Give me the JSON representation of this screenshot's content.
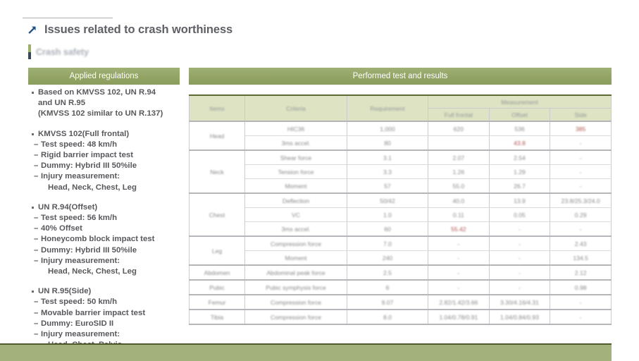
{
  "slide": {
    "title": "Issues related to crash worthiness",
    "title_icon": "arrow-up-right-icon",
    "subtitle": "Crash safety",
    "accent_green": "#9cb06b",
    "accent_dark": "#37495a",
    "header_green": "#93a566",
    "title_color": "#5e6066"
  },
  "columns": {
    "left_header": "Applied regulations",
    "right_header": "Performed test and results"
  },
  "left_column": {
    "blocks": [
      {
        "bullet": "Based on KMVSS 102, UN R.94",
        "continuations": [
          "and UN R.95",
          "(KMVSS 102 similar to UN R.137)"
        ],
        "sub_items": []
      },
      {
        "bullet": "KMVSS 102(Full frontal)",
        "continuations": [],
        "sub_items": [
          {
            "text": "Test speed: 48 km/h",
            "detail": ""
          },
          {
            "text": "Rigid barrier impact test",
            "detail": ""
          },
          {
            "text": "Dummy: Hybrid III 50%ile",
            "detail": ""
          },
          {
            "text": "Injury measurement:",
            "detail": "Head, Neck, Chest, Leg"
          }
        ]
      },
      {
        "bullet": "UN R.94(Offset)",
        "continuations": [],
        "sub_items": [
          {
            "text": "Test speed: 56 km/h",
            "detail": ""
          },
          {
            "text": "40% Offset",
            "detail": ""
          },
          {
            "text": "Honeycomb block impact test",
            "detail": ""
          },
          {
            "text": "Dummy: Hybrid III 50%ile",
            "detail": ""
          },
          {
            "text": "Injury measurement:",
            "detail": "Head, Neck, Chest, Leg"
          }
        ]
      },
      {
        "bullet": "UN R.95(Side)",
        "continuations": [],
        "sub_items": [
          {
            "text": "Test speed: 50 km/h",
            "detail": ""
          },
          {
            "text": "Movable barrier impact test",
            "detail": ""
          },
          {
            "text": "Dummy: EuroSID II",
            "detail": ""
          },
          {
            "text": "Injury measurement:",
            "detail": "Head, Chest, Pelvis"
          }
        ]
      }
    ]
  },
  "table": {
    "headers": {
      "item": "Items",
      "condition": "Criteria",
      "requirement": "Requirement",
      "group": "Measurement",
      "m1": "Full frontal",
      "m2": "Offset",
      "m3": "Side"
    },
    "rows": [
      {
        "group": "Head",
        "group_span": 2,
        "section_start": true,
        "cells": [
          "HIC36",
          "1,000",
          "620",
          "536",
          "385"
        ],
        "red": [
          4
        ]
      },
      {
        "group": "",
        "group_span": 0,
        "section_start": false,
        "cells": [
          "3ms accel.",
          "80",
          "",
          "43.8",
          "-"
        ],
        "red": [
          3
        ]
      },
      {
        "group": "Neck",
        "group_span": 3,
        "section_start": true,
        "cells": [
          "Shear force",
          "3.1",
          "2.07",
          "2.54",
          "-"
        ],
        "red": []
      },
      {
        "group": "",
        "group_span": 0,
        "section_start": false,
        "cells": [
          "Tension force",
          "3.3",
          "1.26",
          "1.29",
          "-"
        ],
        "red": []
      },
      {
        "group": "",
        "group_span": 0,
        "section_start": false,
        "cells": [
          "Moment",
          "57",
          "55.0",
          "26.7",
          "-"
        ],
        "red": []
      },
      {
        "group": "Chest",
        "group_span": 3,
        "section_start": true,
        "cells": [
          "Deflection",
          "50/42",
          "40.0",
          "13.9",
          "23.8/25.3/24.0"
        ],
        "red": []
      },
      {
        "group": "",
        "group_span": 0,
        "section_start": false,
        "cells": [
          "VC",
          "1.0",
          "0.11",
          "0.05",
          "0.29"
        ],
        "red": []
      },
      {
        "group": "",
        "group_span": 0,
        "section_start": false,
        "cells": [
          "3ms accel.",
          "60",
          "55.42",
          "-",
          "-"
        ],
        "red": [
          2
        ]
      },
      {
        "group": "Leg",
        "group_span": 2,
        "section_start": true,
        "cells": [
          "Compression force",
          "7.0",
          "-",
          "-",
          "2.43"
        ],
        "red": []
      },
      {
        "group": "",
        "group_span": 0,
        "section_start": false,
        "cells": [
          "Moment",
          "240",
          "-",
          "-",
          "134.5"
        ],
        "red": []
      },
      {
        "group": "Abdomen",
        "group_span": 1,
        "section_start": true,
        "cells": [
          "Abdominal peak force",
          "2.5",
          "-",
          "-",
          "2.12"
        ],
        "red": []
      },
      {
        "group": "Pubic",
        "group_span": 1,
        "section_start": true,
        "cells": [
          "Pubic symphysis force",
          "6",
          "-",
          "-",
          "0.98"
        ],
        "red": []
      },
      {
        "group": "Femur",
        "group_span": 1,
        "section_start": true,
        "cells": [
          "Compression force",
          "9.07",
          "2.82/1.42/3.66",
          "3.30/4.16/4.31",
          "-"
        ],
        "red": []
      },
      {
        "group": "Tibia",
        "group_span": 1,
        "section_start": true,
        "last": true,
        "cells": [
          "Compression force",
          "8.0",
          "1.04/0.78/0.91",
          "1.04/0.84/0.93",
          "-"
        ],
        "red": []
      }
    ]
  }
}
